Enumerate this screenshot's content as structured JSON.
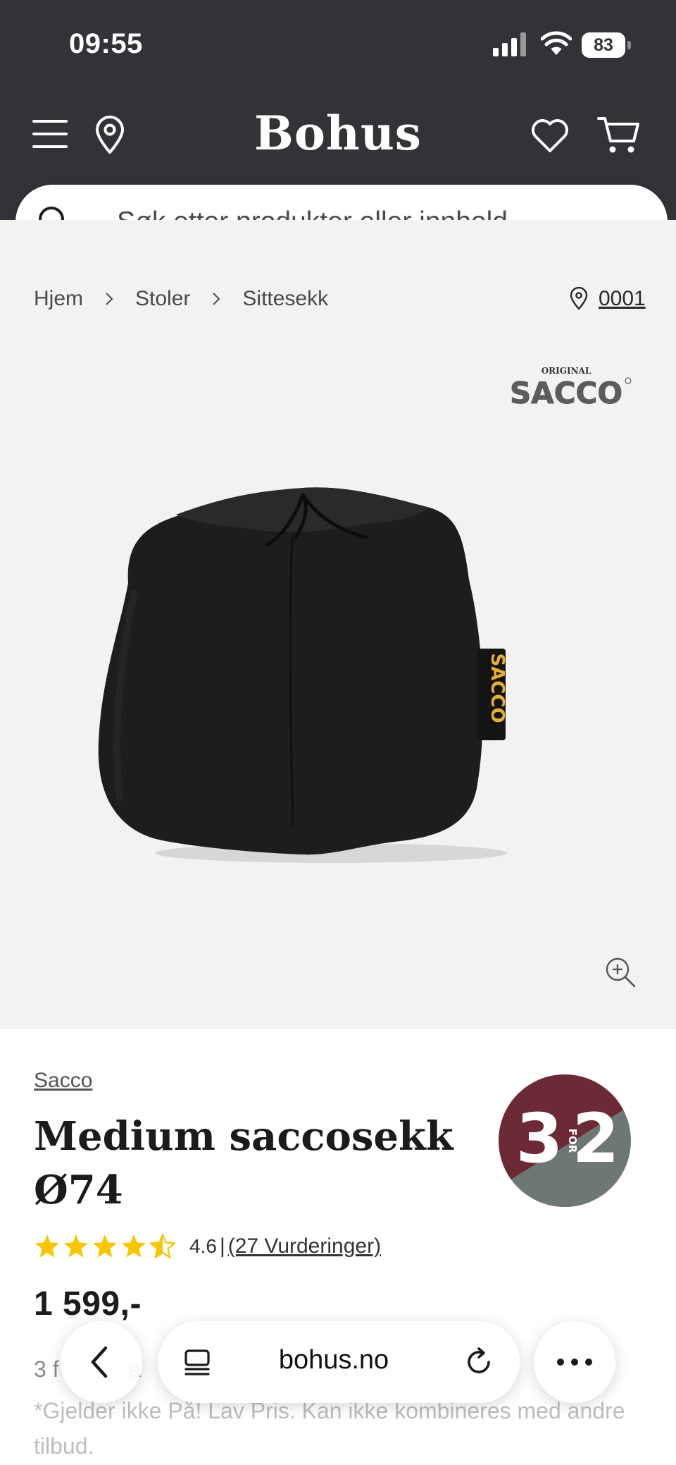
{
  "status_bar": {
    "time": "09:55",
    "battery": "83",
    "icons": [
      "signal-icon",
      "wifi-icon",
      "battery-icon"
    ]
  },
  "header": {
    "brand": "Bohus",
    "icons": [
      "menu-icon",
      "location-icon",
      "heart-icon",
      "cart-icon"
    ]
  },
  "search": {
    "placeholder": "Søk etter produkter eller innhold..."
  },
  "breadcrumb": {
    "items": [
      "Hjem",
      "Stoler",
      "Sittesekk"
    ],
    "store": "0001"
  },
  "product": {
    "brand_logo_top": "ORIGINAL",
    "brand_logo": "SACCO",
    "brand": "Sacco",
    "title_line1": "Medium saccosekk",
    "title_line2": "Ø74",
    "badge": {
      "left": "3",
      "middle": "FOR",
      "right": "2",
      "color_top": "#6b2a36",
      "color_bottom": "#6f7775"
    },
    "rating": 4.6,
    "rating_text": "4.6",
    "rating_sep": "|",
    "reviews": "(27 Vurderinger)",
    "price": "1 599,-",
    "offer_line": "3 f",
    "offer_line_2": "a",
    "offer_note": "*Gjelder ikke På! Lav Pris. Kan ikke kombineres med andre tilbud."
  },
  "browser": {
    "url": "bohus.no",
    "icons": [
      "back-icon",
      "tabs-icon",
      "reload-icon",
      "more-icon"
    ]
  },
  "colors": {
    "header_bg": "#333236",
    "image_bg": "#f3f2f0",
    "star": "#f7c600"
  }
}
